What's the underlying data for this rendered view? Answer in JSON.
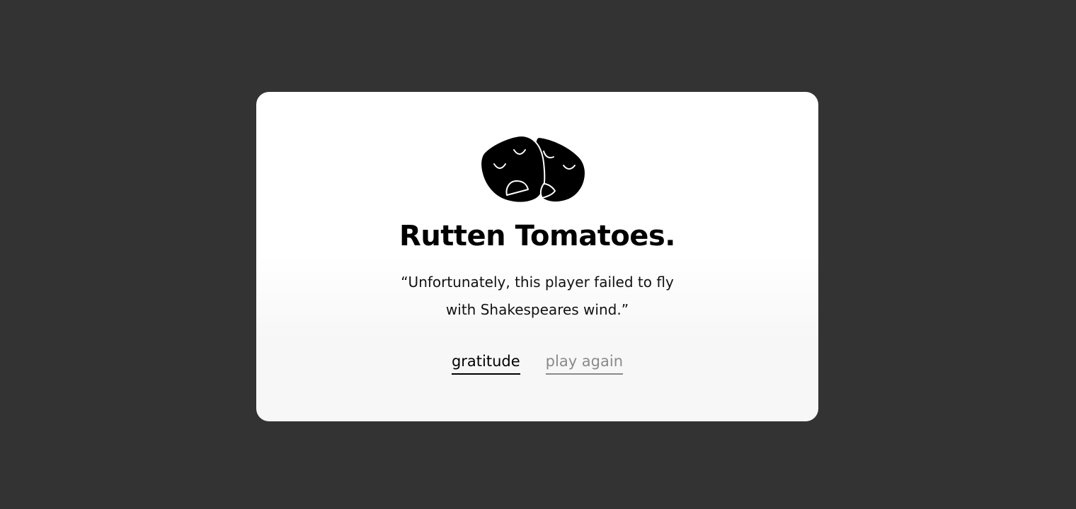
{
  "modal": {
    "title": "Rutten Tomatoes.",
    "quote_line1": "“Unfortunately, this player failed to fly",
    "quote_line2": "with Shakespeares wind.”",
    "icon": "theater-masks-sad-icon"
  },
  "actions": {
    "gratitude_label": "gratitude",
    "play_again_label": "play again"
  },
  "colors": {
    "backdrop": "#333333",
    "card": "#ffffff",
    "text": "#000000",
    "muted_link": "#8a8a8a"
  }
}
